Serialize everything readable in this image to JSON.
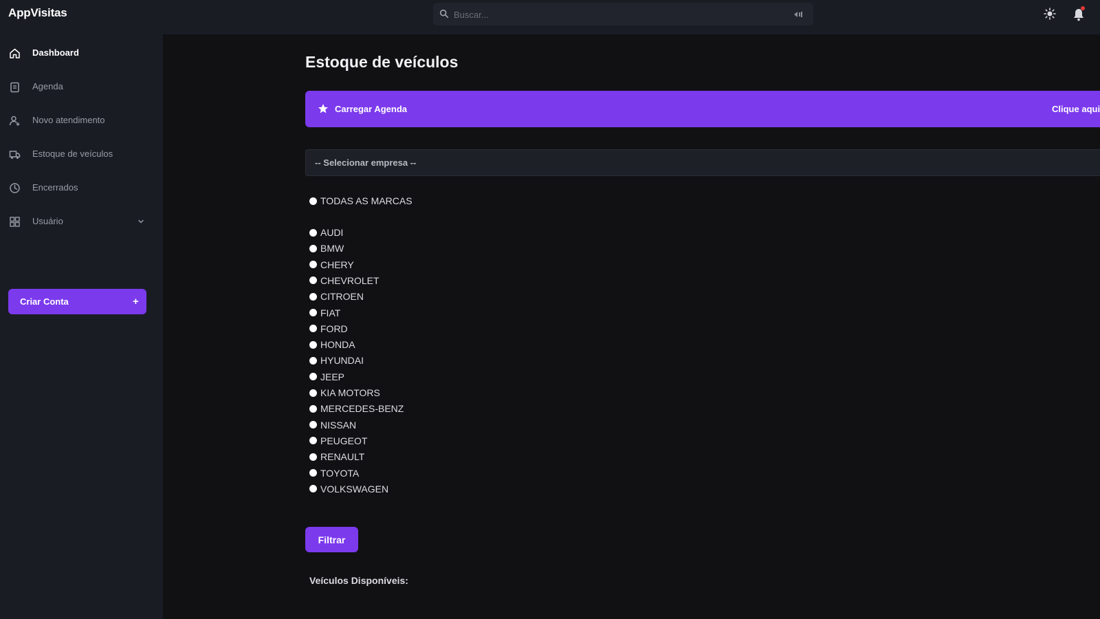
{
  "app": {
    "title": "AppVisitas"
  },
  "search": {
    "placeholder": "Buscar..."
  },
  "header_icons": [
    "search-icon",
    "keyboard-icon",
    "sun-icon",
    "bell-icon"
  ],
  "colors": {
    "accent": "#7c3aed",
    "background": "#111114",
    "panel": "#1a1c24"
  },
  "sidebar": {
    "items": [
      {
        "label": "Dashboard",
        "icon": "home-icon",
        "active": true
      },
      {
        "label": "Agenda",
        "icon": "clipboard-icon"
      },
      {
        "label": "Novo atendimento",
        "icon": "user-add-icon"
      },
      {
        "label": "Estoque de veículos",
        "icon": "truck-icon"
      },
      {
        "label": "Encerrados",
        "icon": "clock-icon"
      },
      {
        "label": "Usuário",
        "icon": "grid-icon",
        "expandable": true
      }
    ],
    "create_button": {
      "label": "Criar Conta",
      "icon": "+"
    }
  },
  "main": {
    "title": "Estoque de veículos",
    "banner": {
      "label": "Carregar Agenda",
      "right_text": "Clique aqui"
    },
    "company_select": {
      "value": "-- Selecionar empresa --"
    },
    "brands": {
      "all_label": "TODAS AS MARCAS",
      "options": [
        "AUDI",
        "BMW",
        "CHERY",
        "CHEVROLET",
        "CITROEN",
        "FIAT",
        "FORD",
        "HONDA",
        "HYUNDAI",
        "JEEP",
        "KIA MOTORS",
        "MERCEDES-BENZ",
        "NISSAN",
        "PEUGEOT",
        "RENAULT",
        "TOYOTA",
        "VOLKSWAGEN"
      ]
    },
    "filter_button": "Filtrar",
    "available_label": "Veículos Disponíveis:"
  }
}
